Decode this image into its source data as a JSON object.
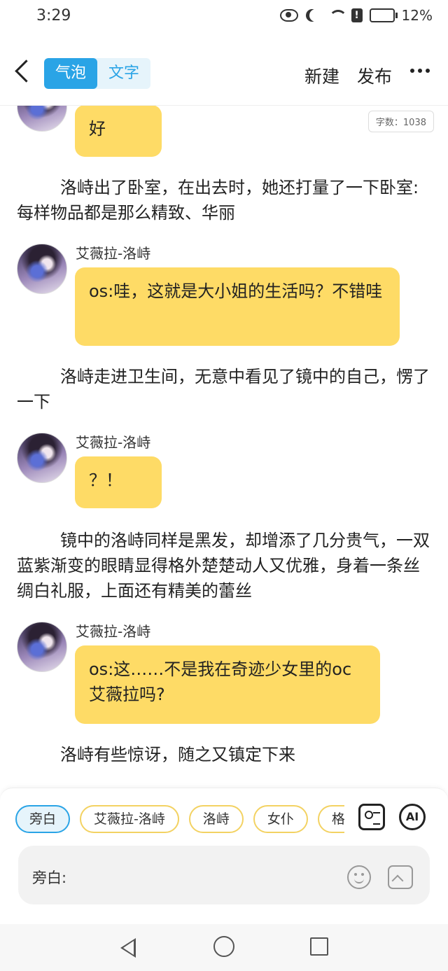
{
  "status_bar": {
    "time": "3:29",
    "battery_percent": "12%"
  },
  "header": {
    "tabs": [
      "气泡",
      "文字"
    ],
    "active_tab": "气泡",
    "new_label": "新建",
    "publish_label": "发布"
  },
  "word_count": "字数：1038",
  "messages": {
    "m1": {
      "text": "好"
    },
    "n1": {
      "text": "洛峙出了卧室，在出去时，她还打量了一下卧室:每样物品都是那么精致、华丽"
    },
    "m2": {
      "speaker": "艾薇拉-洛峙",
      "text": "os:哇，这就是大小姐的生活吗？不错哇"
    },
    "n2": {
      "text": "洛峙走进卫生间，无意中看见了镜中的自己，愣了一下"
    },
    "m3": {
      "speaker": "艾薇拉-洛峙",
      "text": "？！"
    },
    "n3": {
      "text": "镜中的洛峙同样是黑发，却增添了几分贵气，一双蓝紫渐变的眼睛显得格外楚楚动人又优雅，身着一条丝绸白礼服，上面还有精美的蕾丝"
    },
    "m4": {
      "speaker": "艾薇拉-洛峙",
      "text": "os:这……不是我在奇迹少女里的oc艾薇拉吗?"
    },
    "n4": {
      "text": "洛峙有些惊讶，随之又镇定下来"
    }
  },
  "composer": {
    "chips": [
      "旁白",
      "艾薇拉-洛峙",
      "洛峙",
      "女仆",
      "格雷"
    ],
    "active_chip": "旁白",
    "ai_label": "AI",
    "input_label": "旁白:"
  },
  "colors": {
    "accent": "#2aa4e6",
    "bubble": "#fedb66",
    "chip_border": "#f3d262"
  },
  "icons": [
    "eye-icon",
    "moon-icon",
    "wifi-icon",
    "alert-icon",
    "battery-icon",
    "back-icon",
    "more-icon",
    "character-card-icon",
    "ai-icon",
    "emoji-icon",
    "image-icon",
    "nav-back-icon",
    "nav-home-icon",
    "nav-recent-icon"
  ]
}
